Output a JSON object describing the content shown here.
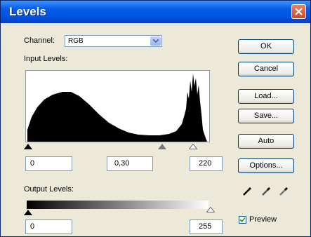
{
  "window": {
    "title": "Levels"
  },
  "channel": {
    "label": "Channel:",
    "value": "RGB"
  },
  "input_levels": {
    "label": "Input Levels:",
    "black": "0",
    "gamma": "0,30",
    "white": "220"
  },
  "output_levels": {
    "label": "Output Levels:",
    "black": "0",
    "white": "255"
  },
  "buttons": {
    "ok": "OK",
    "cancel": "Cancel",
    "load": "Load...",
    "save": "Save...",
    "auto": "Auto",
    "options": "Options..."
  },
  "preview": {
    "label": "Preview",
    "checked": true
  },
  "icons": [
    "close-icon",
    "dropdown-arrow-icon",
    "black-eyedropper-icon",
    "gray-eyedropper-icon",
    "white-eyedropper-icon"
  ],
  "colors": {
    "titlebar": "#0054e3",
    "dialog_bg": "#ece9d8",
    "histogram_fill": "#000000"
  }
}
